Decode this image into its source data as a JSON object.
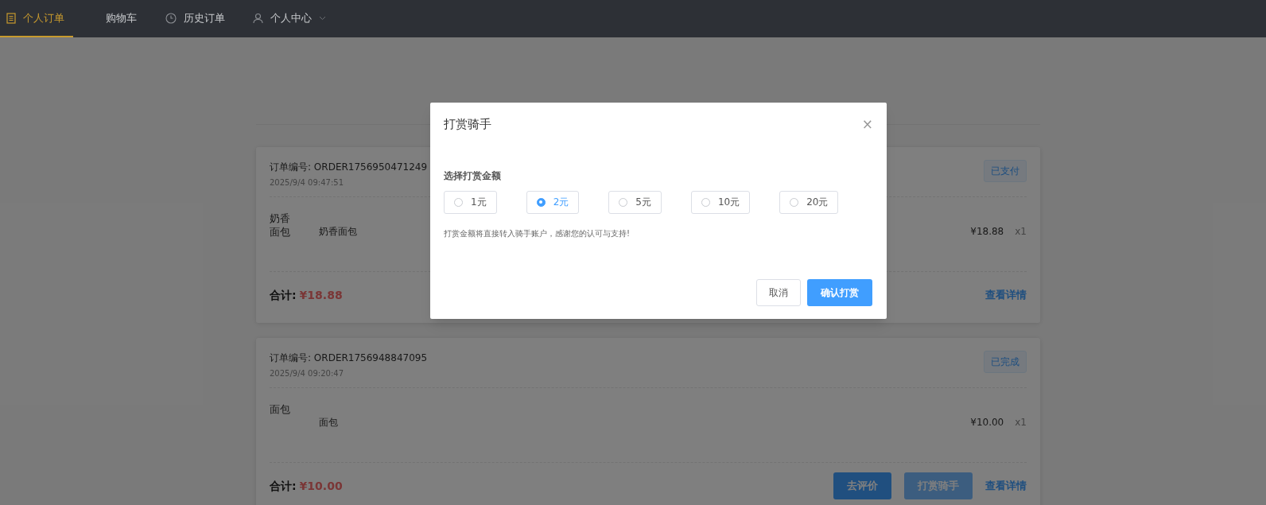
{
  "nav": {
    "items": [
      {
        "label": "个人订单",
        "kind": "document",
        "selected": true
      },
      {
        "label": "购物车",
        "kind": "plain",
        "selected": false
      },
      {
        "label": "历史订单",
        "kind": "clock",
        "selected": false
      },
      {
        "label": "个人中心",
        "kind": "user",
        "selected": false,
        "dropdown": true
      }
    ]
  },
  "orders": [
    {
      "order_no": "订单编号: ORDER1756950471249",
      "time": "2025/9/4 09:47:51",
      "status": "已支付",
      "items": [
        {
          "image_alt": "奶香面包",
          "name": "奶香面包",
          "price": "¥18.88",
          "qty": "x1"
        }
      ],
      "total_label": "合计:",
      "total": "¥18.88",
      "actions": [
        {
          "label": "查看详情",
          "kind": "link"
        }
      ]
    },
    {
      "order_no": "订单编号: ORDER1756948847095",
      "time": "2025/9/4 09:20:47",
      "status": "已完成",
      "items": [
        {
          "image_alt": "面包",
          "name": "面包",
          "price": "¥10.00",
          "qty": "x1"
        }
      ],
      "total_label": "合计:",
      "total": "¥10.00",
      "actions": [
        {
          "label": "去评价",
          "kind": "primary"
        },
        {
          "label": "打赏骑手",
          "kind": "light"
        },
        {
          "label": "查看详情",
          "kind": "link"
        }
      ]
    }
  ],
  "dialog": {
    "title": "打赏骑手",
    "close": "×",
    "label": "选择打赏金额",
    "options": [
      {
        "label": "1元",
        "selected": false
      },
      {
        "label": "2元",
        "selected": true
      },
      {
        "label": "5元",
        "selected": false
      },
      {
        "label": "10元",
        "selected": false
      },
      {
        "label": "20元",
        "selected": false
      }
    ],
    "hint": "打赏金额将直接转入骑手账户，感谢您的认可与支持!",
    "buttons": [
      {
        "label": "取消",
        "kind": "default"
      },
      {
        "label": "确认打赏",
        "kind": "primary"
      }
    ]
  }
}
